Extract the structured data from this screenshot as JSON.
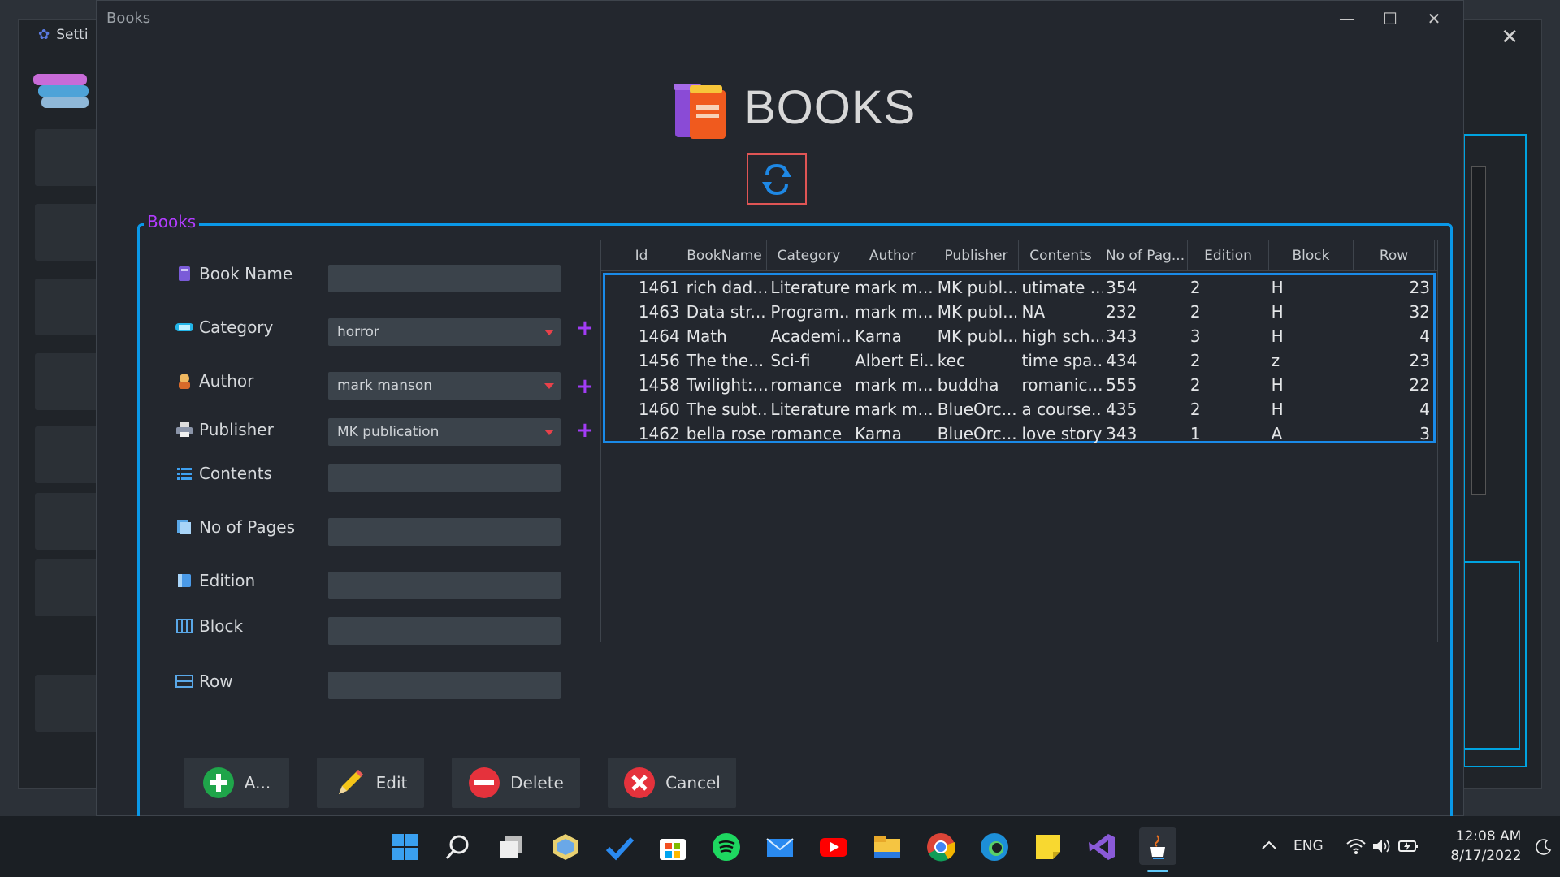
{
  "background_window": {
    "title": "Setti"
  },
  "window": {
    "title": "Books"
  },
  "header": {
    "title": "BOOKS"
  },
  "panel": {
    "legend": "Books"
  },
  "form": {
    "book_name": {
      "label": "Book Name",
      "value": ""
    },
    "category": {
      "label": "Category",
      "value": "horror"
    },
    "author": {
      "label": "Author",
      "value": "mark manson"
    },
    "publisher": {
      "label": "Publisher",
      "value": "MK publication"
    },
    "contents": {
      "label": "Contents",
      "value": ""
    },
    "no_of_pages": {
      "label": "No of Pages",
      "value": ""
    },
    "edition": {
      "label": "Edition",
      "value": ""
    },
    "block": {
      "label": "Block",
      "value": ""
    },
    "row": {
      "label": "Row",
      "value": ""
    },
    "add_symbol": "+"
  },
  "table": {
    "columns": [
      "Id",
      "BookName",
      "Category",
      "Author",
      "Publisher",
      "Contents",
      "No of Pag...",
      "Edition",
      "Block",
      "Row"
    ],
    "rows": [
      [
        "1461",
        "rich dad...",
        "Literature",
        "mark m...",
        "MK publ...",
        "utimate ...",
        "354",
        "2",
        "H",
        "23"
      ],
      [
        "1463",
        "Data str...",
        "Program...",
        "mark m...",
        "MK publ...",
        "NA",
        "232",
        "2",
        "H",
        "32"
      ],
      [
        "1464",
        "Math",
        "Academi...",
        "Karna",
        "MK publ...",
        "high sch...",
        "343",
        "3",
        "H",
        "4"
      ],
      [
        "1456",
        "The the...",
        "Sci-fi",
        "Albert Ei...",
        "kec",
        "time spa...",
        "434",
        "2",
        "z",
        "23"
      ],
      [
        "1458",
        "Twilight:...",
        "romance",
        "mark m...",
        "buddha",
        "romanic...",
        "555",
        "2",
        "H",
        "22"
      ],
      [
        "1460",
        "The subt...",
        "Literature",
        "mark m...",
        "BlueOrc...",
        "a course...",
        "435",
        "2",
        "H",
        "4"
      ],
      [
        "1462",
        "bella rose",
        "romance",
        "Karna",
        "BlueOrc...",
        "love story",
        "343",
        "1",
        "A",
        "3"
      ]
    ]
  },
  "buttons": {
    "add": "A...",
    "edit": "Edit",
    "delete": "Delete",
    "cancel": "Cancel"
  },
  "tray": {
    "lang": "ENG",
    "time": "12:08 AM",
    "date": "8/17/2022"
  },
  "colors": {
    "accent": "#0a98e8",
    "legend": "#b23cff",
    "plus": "#a23cf5",
    "refresh_border": "#e05555"
  }
}
